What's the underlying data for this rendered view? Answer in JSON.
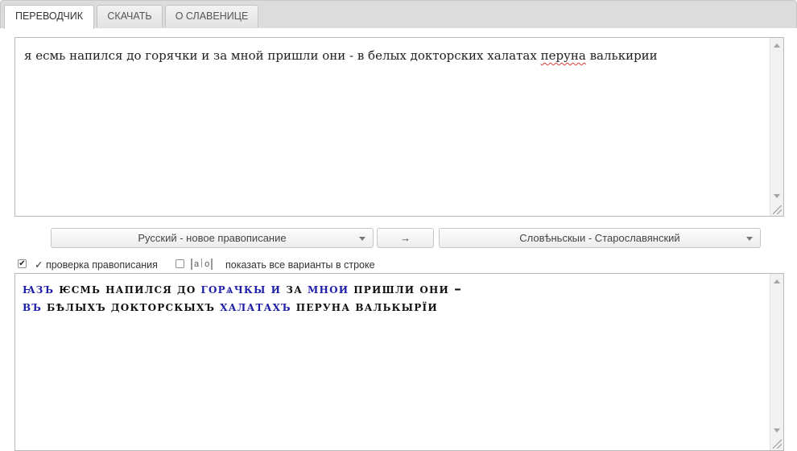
{
  "tabs": [
    {
      "label": "ПЕРЕВОДЧИК",
      "active": true
    },
    {
      "label": "СКАЧАТЬ",
      "active": false
    },
    {
      "label": "О СЛАВЕНИЦЕ",
      "active": false
    }
  ],
  "input": {
    "before": "я есмь напился до горячки и за мной пришли они - в белых докторских халатах ",
    "misspelled_1": "перуна",
    "between": " ",
    "misspelled_2": "валькирии"
  },
  "languages": {
    "source": "Русский - новое правописание",
    "swap_label": "→",
    "target": "Словѣньскыи - Старославянский"
  },
  "options": {
    "spellcheck_checked": true,
    "spellcheck_label": "✓ проверка правописания",
    "variants_checked": false,
    "variants_icon_a": "а",
    "variants_icon_o": "о",
    "variants_label": "показать все варианты в строке"
  },
  "output": {
    "words": [
      {
        "text": "ꙗзъ",
        "blue": true
      },
      {
        "text": "ѥсмь",
        "blue": false
      },
      {
        "text": "напился",
        "blue": false
      },
      {
        "text": "до",
        "blue": false
      },
      {
        "text": "горѧчкы",
        "blue": true
      },
      {
        "text": "и",
        "blue": true
      },
      {
        "text": "за",
        "blue": false
      },
      {
        "text": "мнои",
        "blue": true
      },
      {
        "text": "пришли",
        "blue": false
      },
      {
        "text": "они",
        "blue": false
      },
      {
        "text": "–",
        "blue": false
      },
      {
        "text": "въ",
        "blue": true
      },
      {
        "text": "бѣлыхъ",
        "blue": false
      },
      {
        "text": "докторскыхъ",
        "blue": false
      },
      {
        "text": "халатахъ",
        "blue": true
      },
      {
        "text": "перуна",
        "blue": false
      },
      {
        "text": "валькырїи",
        "blue": false
      }
    ]
  },
  "colors": {
    "accent_blue": "#1d1da8",
    "spell_underline": "#e23a3a"
  }
}
